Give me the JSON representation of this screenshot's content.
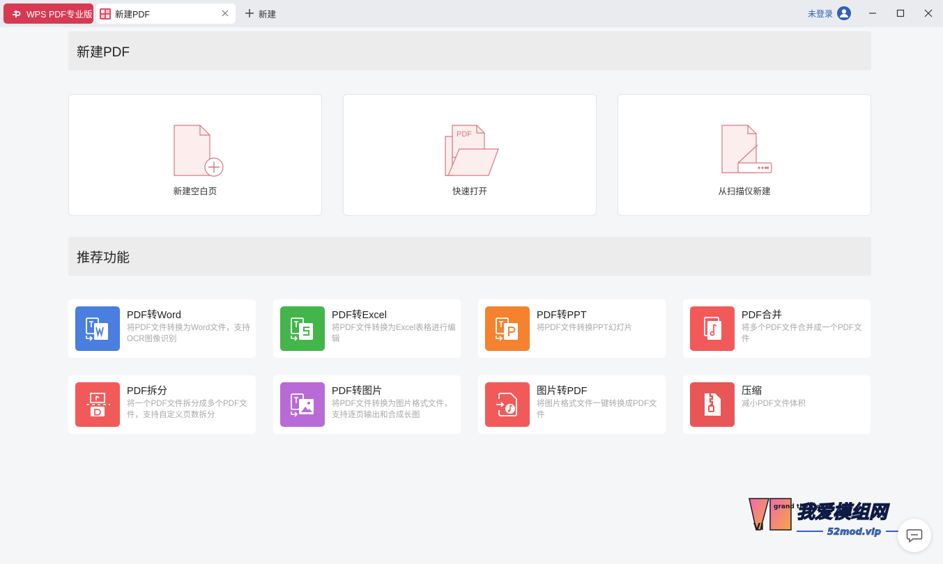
{
  "titlebar": {
    "app_tab_label": "WPS PDF专业版",
    "doc_tab_label": "新建PDF",
    "new_tab_label": "新建",
    "login_label": "未登录"
  },
  "sections": {
    "new_pdf_title": "新建PDF",
    "recommended_title": "推荐功能"
  },
  "cards": [
    {
      "label": "新建空白页"
    },
    {
      "label": "快速打开",
      "icon_text": "PDF"
    },
    {
      "label": "从扫描仪新建"
    }
  ],
  "features": [
    {
      "title": "PDF转Word",
      "desc": "将PDF文件转换为Word文件，支持OCR图像识别",
      "color": "#4a7fe0"
    },
    {
      "title": "PDF转Excel",
      "desc": "将PDF文件转换为Excel表格进行编辑",
      "color": "#43b54a"
    },
    {
      "title": "PDF转PPT",
      "desc": "将PDF文件转换PPT幻灯片",
      "color": "#f5822f"
    },
    {
      "title": "PDF合并",
      "desc": "将多个PDF文件合并成一个PDF文件",
      "color": "#f25a5a"
    },
    {
      "title": "PDF拆分",
      "desc": "将一个PDF文件拆分成多个PDF文件，支持自定义页数拆分",
      "color": "#f25a5a"
    },
    {
      "title": "PDF转图片",
      "desc": "将PDF文件转换为图片格式文件，支持逐页输出和合成长图",
      "color": "#b86ad6"
    },
    {
      "title": "图片转PDF",
      "desc": "将图片格式文件一键转换成PDF文件",
      "color": "#f25a5a"
    },
    {
      "title": "压缩",
      "desc": "减小PDF文件体积",
      "color": "#e85656"
    }
  ],
  "watermark": {
    "line1": "我爱模组网",
    "line2": "52mod.vip",
    "badge": "grand theft auto",
    "badge_numeral": "VI"
  },
  "colors": {
    "accent": "#d63a52",
    "card_icon_stroke": "#d9777f",
    "card_icon_fill": "#fdeeee"
  }
}
